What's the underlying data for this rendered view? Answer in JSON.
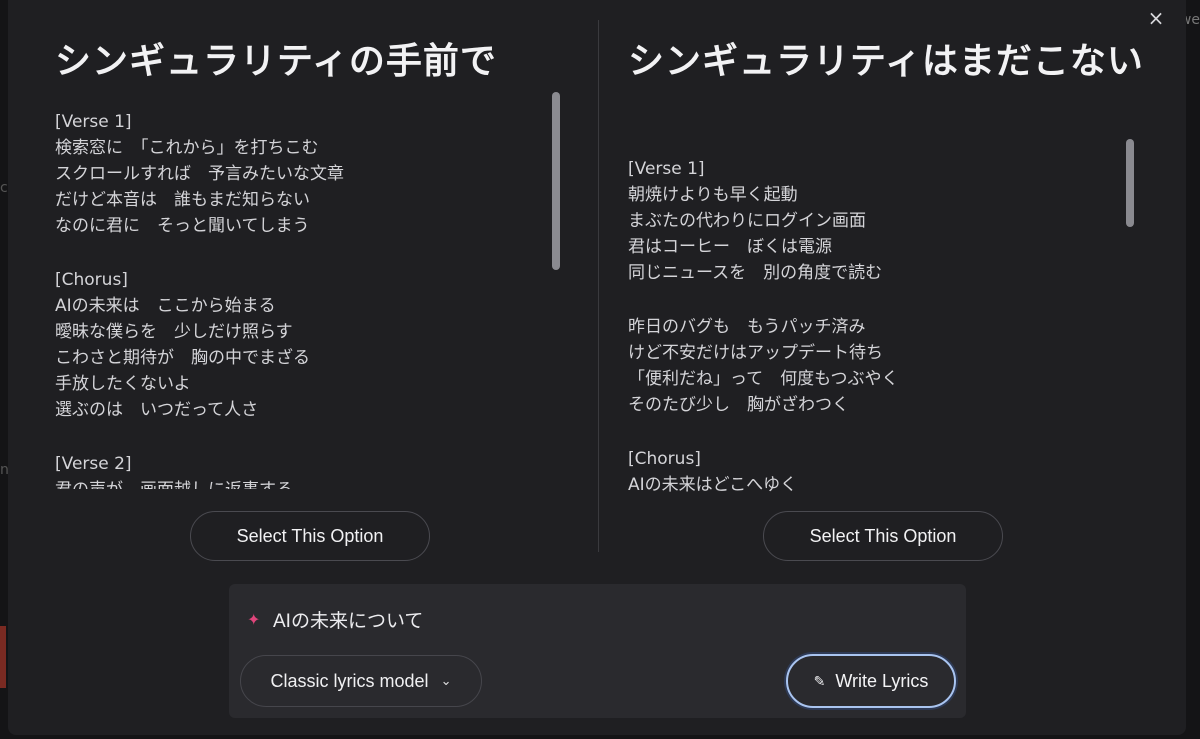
{
  "background": {
    "left_fragment_1": "c",
    "left_fragment_2": "n",
    "right_fragment": "we"
  },
  "modal": {
    "close_icon": "×"
  },
  "options": [
    {
      "title": "シンギュラリティの手前で",
      "lyrics": [
        "[Verse 1]",
        "検索窓に　「これから」を打ちこむ",
        "スクロールすれば　予言みたいな文章",
        "だけど本音は　誰もまだ知らない",
        "なのに君に　そっと聞いてしまう",
        "",
        "[Chorus]",
        "AIの未来は　ここから始まる",
        "曖昧な僕らを　少しだけ照らす",
        "こわさと期待が　胸の中でまざる",
        "手放したくないよ",
        "選ぶのは　いつだって人さ",
        "",
        "[Verse 2]",
        "君の声が　画面越しに返事する"
      ],
      "select_label": "Select This Option"
    },
    {
      "title": "シンギュラリティはまだこない",
      "lyrics": [
        "[Verse 1]",
        "朝焼けよりも早く起動",
        "まぶたの代わりにログイン画面",
        "君はコーヒー　ぼくは電源",
        "同じニュースを　別の角度で読む",
        "",
        "昨日のバグも　もうパッチ済み",
        "けど不安だけはアップデート待ち",
        "「便利だね」って　何度もつぶやく",
        "そのたび少し　胸がざわつく",
        "",
        "[Chorus]",
        "AIの未来はどこへゆく"
      ],
      "select_label": "Select This Option"
    }
  ],
  "prompt": {
    "sparkle_icon": "✦",
    "text": "AIの未来について",
    "model_label": "Classic lyrics model",
    "chevron_icon": "⌄",
    "write_label": "Write Lyrics",
    "pencil_icon": "✎"
  },
  "colors": {
    "accent_sparkle": "#e0457b",
    "write_button_border": "#a9c4f0",
    "modal_bg": "#1f1f22"
  }
}
